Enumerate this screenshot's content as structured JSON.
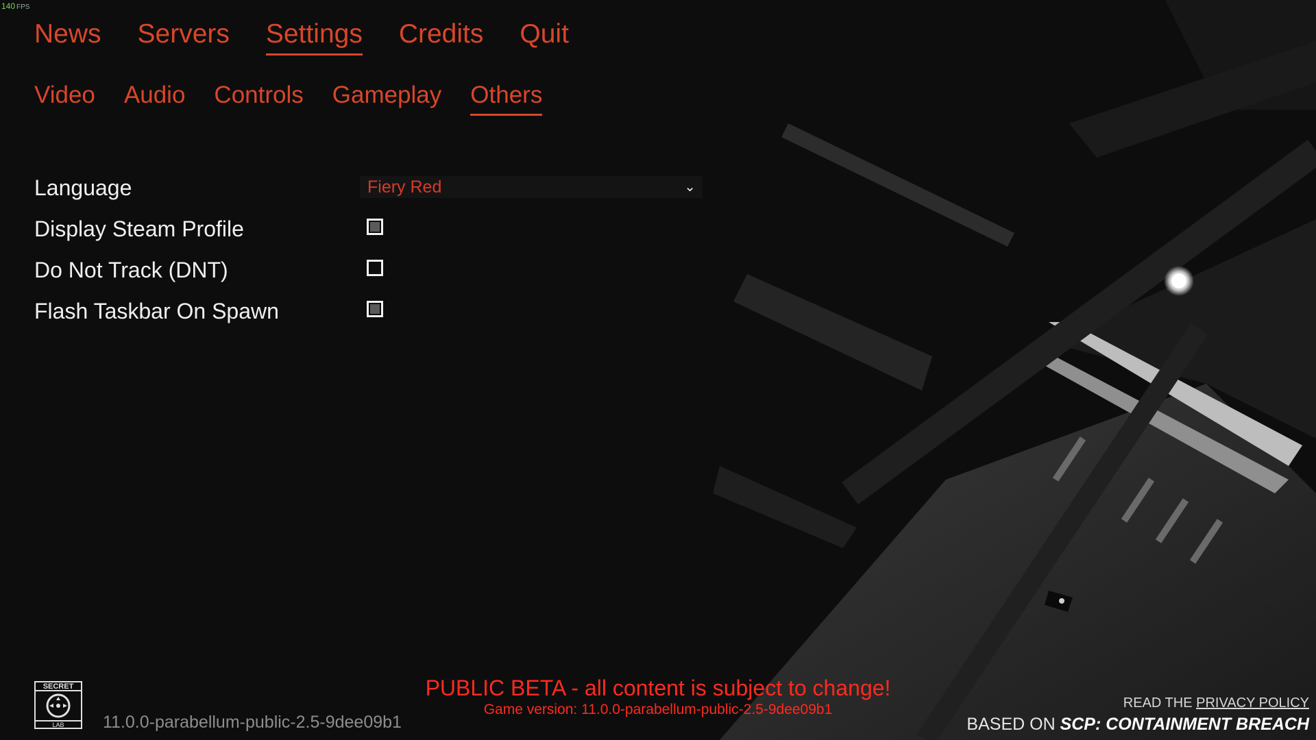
{
  "fps": {
    "value": "140",
    "unit": "FPS"
  },
  "top_nav": {
    "items": [
      "News",
      "Servers",
      "Settings",
      "Credits",
      "Quit"
    ],
    "active": "Settings"
  },
  "sub_nav": {
    "items": [
      "Video",
      "Audio",
      "Controls",
      "Gameplay",
      "Others"
    ],
    "active": "Others"
  },
  "settings": {
    "language": {
      "label": "Language",
      "value": "Fiery Red"
    },
    "display_steam_profile": {
      "label": "Display Steam Profile",
      "checked": true
    },
    "do_not_track": {
      "label": "Do Not Track (DNT)",
      "checked": false
    },
    "flash_taskbar": {
      "label": "Flash Taskbar On Spawn",
      "checked": true
    }
  },
  "footer": {
    "logo_text_top": "SECRET",
    "logo_text_bottom": "LAB",
    "version": "11.0.0-parabellum-public-2.5-9dee09b1",
    "beta_notice": "PUBLIC BETA - all content is subject to change!",
    "game_version": "Game version: 11.0.0-parabellum-public-2.5-9dee09b1",
    "privacy_prefix": "READ THE ",
    "privacy_link": "PRIVACY POLICY",
    "based_on_prefix": "BASED ON ",
    "based_on_title": "SCP: CONTAINMENT BREACH"
  },
  "colors": {
    "accent": "#d9462a",
    "beta_red": "#ff2a1f",
    "fps_green": "#7fd35a"
  }
}
